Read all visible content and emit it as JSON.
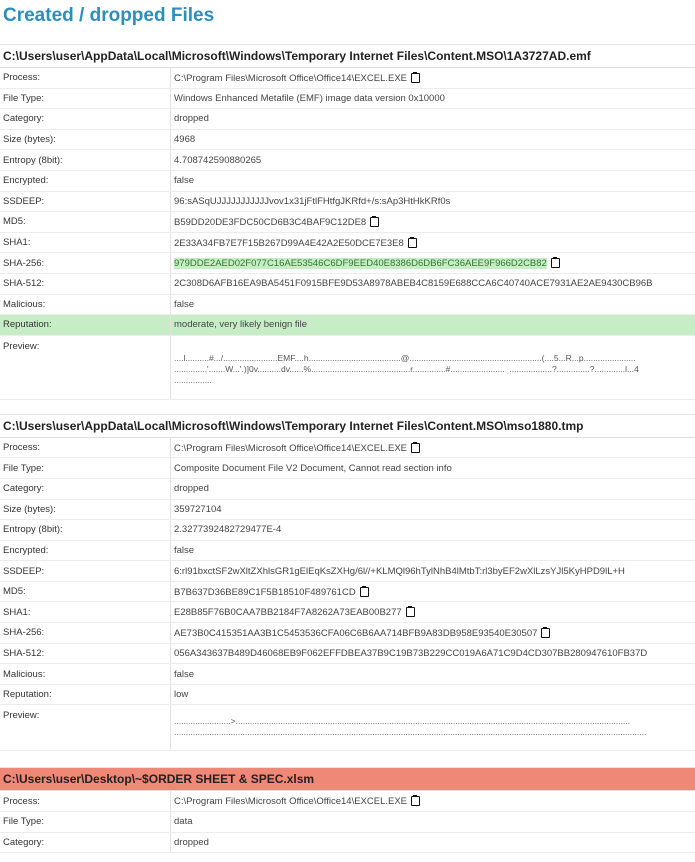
{
  "page_title": "Created / dropped Files",
  "labels": {
    "process": "Process:",
    "file_type": "File Type:",
    "category": "Category:",
    "size": "Size (bytes):",
    "entropy": "Entropy (8bit):",
    "encrypted": "Encrypted:",
    "ssdeep": "SSDEEP:",
    "md5": "MD5:",
    "sha1": "SHA1:",
    "sha256": "SHA-256:",
    "sha512": "SHA-512:",
    "malicious": "Malicious:",
    "reputation": "Reputation:",
    "preview": "Preview:"
  },
  "files": [
    {
      "path": "C:\\Users\\user\\AppData\\Local\\Microsoft\\Windows\\Temporary Internet Files\\Content.MSO\\1A3727AD.emf",
      "process": "C:\\Program Files\\Microsoft Office\\Office14\\EXCEL.EXE",
      "file_type": "Windows Enhanced Metafile (EMF) image data version 0x10000",
      "category": "dropped",
      "size": "4968",
      "entropy": "4.70874259088026​5",
      "encrypted": "false",
      "ssdeep": "96:sASqUJJJJJJJJJJJvov1x31jFtlFHtfgJKRfd+/s:sAp3HtHkKRf0s",
      "md5": "B59DD20DE3FDC50CD6B3C4BAF9C12DE8",
      "sha1": "2E33A34FB7E7F15B267D99A4E42A2E50DCE7E3E8",
      "sha256": "979DDE2AED02F077C16AE53546C6DF9EED40E8386D6DB6FC36AEE9F966D2CB82",
      "sha512": "2C308D6AFB16EA9BA5451F0915BFE9D53A8978ABEB4C8159E688CCA6C40740ACE7931AE2AE9430CB96B",
      "malicious": "false",
      "reputation": "moderate, very likely benign file",
      "preview": "....l..........#.../.......................EMF....h.......................................@........................................................(....5...R...p......................\n..............'.......W...'.)]0v..........dv......%..........................................r..............#.......................  ..................?..............?.............l...4\n................"
    },
    {
      "path": "C:\\Users\\user\\AppData\\Local\\Microsoft\\Windows\\Temporary Internet Files\\Content.MSO\\mso1880.tmp",
      "process": "C:\\Program Files\\Microsoft Office\\Office14\\EXCEL.EXE",
      "file_type": "Composite Document File V2 Document, Cannot read section info",
      "category": "dropped",
      "size": "359727104",
      "entropy": "2.3277392482729477E-4",
      "encrypted": "false",
      "ssdeep": "6:rl91bxctSF2wXltZXhlsGR1gElEqKsZXHg/6l//+KLMQl96hTylNhB4lMtbT:rl3byEF2wXlLzsYJl5KyHPD9lL+H",
      "md5": "B7B637D36BE89C1F5B18510F489761CD",
      "sha1": "E28B85F76B0CAA7BB2184F7A8262A73EAB00B277",
      "sha256": "AE73B0C415351AA3B1C5453536CFA06C6B6AA714BFB9A83DB958E93540E30507",
      "sha512": "056A343637B489D46068EB9F062EFFDBEA37B9C19B73B229CC019A6A71C9D4CD307BB280947610FB37D",
      "malicious": "false",
      "reputation": "low",
      "preview": "........................>.......................................................................................................................................................................\n........................................................................................................................................................................................................"
    },
    {
      "path": "C:\\Users\\user\\Desktop\\~$ORDER SHEET & SPEC.xlsm",
      "process": "C:\\Program Files\\Microsoft Office\\Office14\\EXCEL.EXE",
      "file_type": "data",
      "category": "dropped"
    }
  ]
}
